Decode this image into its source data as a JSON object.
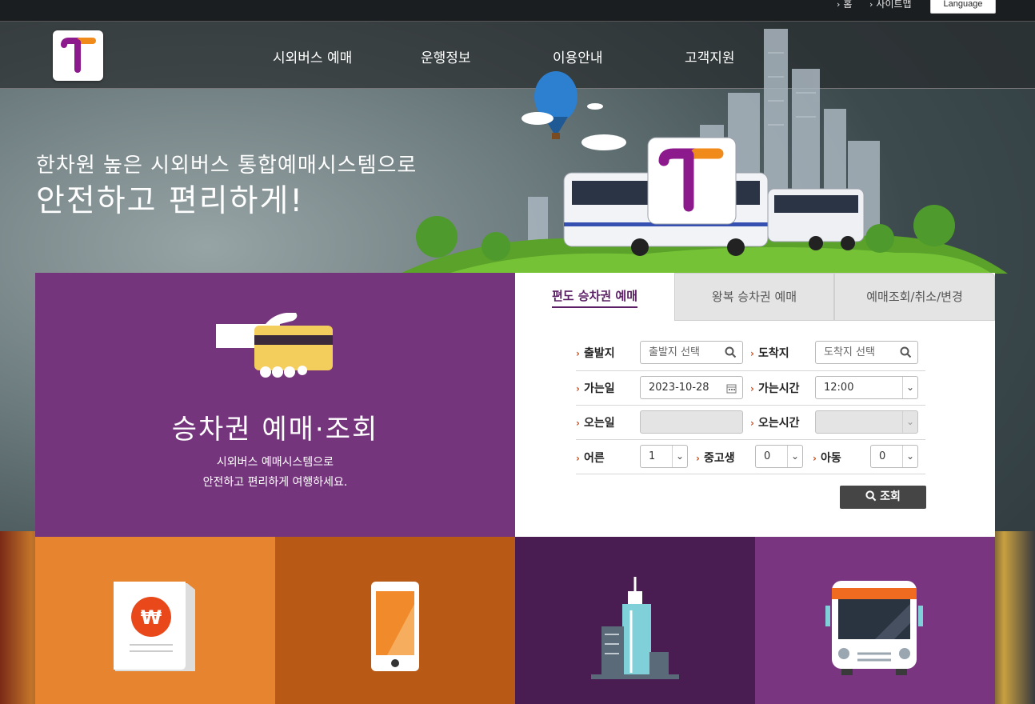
{
  "utility_bar": {
    "home_label": "홈",
    "sitemap_label": "사이트맵",
    "language_label": "Language"
  },
  "nav": {
    "items": [
      "시외버스 예매",
      "운행정보",
      "이용안내",
      "고객지원"
    ]
  },
  "hero": {
    "line1": "한차원 높은 시외버스 통합예매시스템으로",
    "line2": "안전하고 편리하게!"
  },
  "left_panel": {
    "title": "승차권 예매·조회",
    "subtitle_line1": "시외버스 예매시스템으로",
    "subtitle_line2": "안전하고 편리하게 여행하세요."
  },
  "booking": {
    "tabs": [
      "편도 승차권 예매",
      "왕복 승차권 예매",
      "예매조회/취소/변경"
    ],
    "active_tab": 0,
    "departure_label": "출발지",
    "departure_placeholder": "출발지 선택",
    "arrival_label": "도착지",
    "arrival_placeholder": "도착지 선택",
    "go_date_label": "가는일",
    "go_date_value": "2023-10-28",
    "go_time_label": "가는시간",
    "go_time_value": "12:00",
    "return_date_label": "오는일",
    "return_date_value": "",
    "return_time_label": "오는시간",
    "return_time_value": "",
    "adult_label": "어른",
    "adult_value": "1",
    "student_label": "중고생",
    "student_value": "0",
    "child_label": "아동",
    "child_value": "0",
    "search_button": "조회"
  },
  "colors": {
    "brand_purple": "#75357c",
    "tab_purple": "#5a1f64",
    "tile_orange": "#e6842f",
    "tile_dark_orange": "#b85a16",
    "tile_dark_purple": "#4a1d52",
    "tile_purple": "#7a3580",
    "accent_chevron": "#d0501a"
  },
  "tiles": [
    {
      "icon": "receipt-won-icon"
    },
    {
      "icon": "smartphone-icon"
    },
    {
      "icon": "city-building-icon"
    },
    {
      "icon": "bus-front-icon"
    }
  ]
}
